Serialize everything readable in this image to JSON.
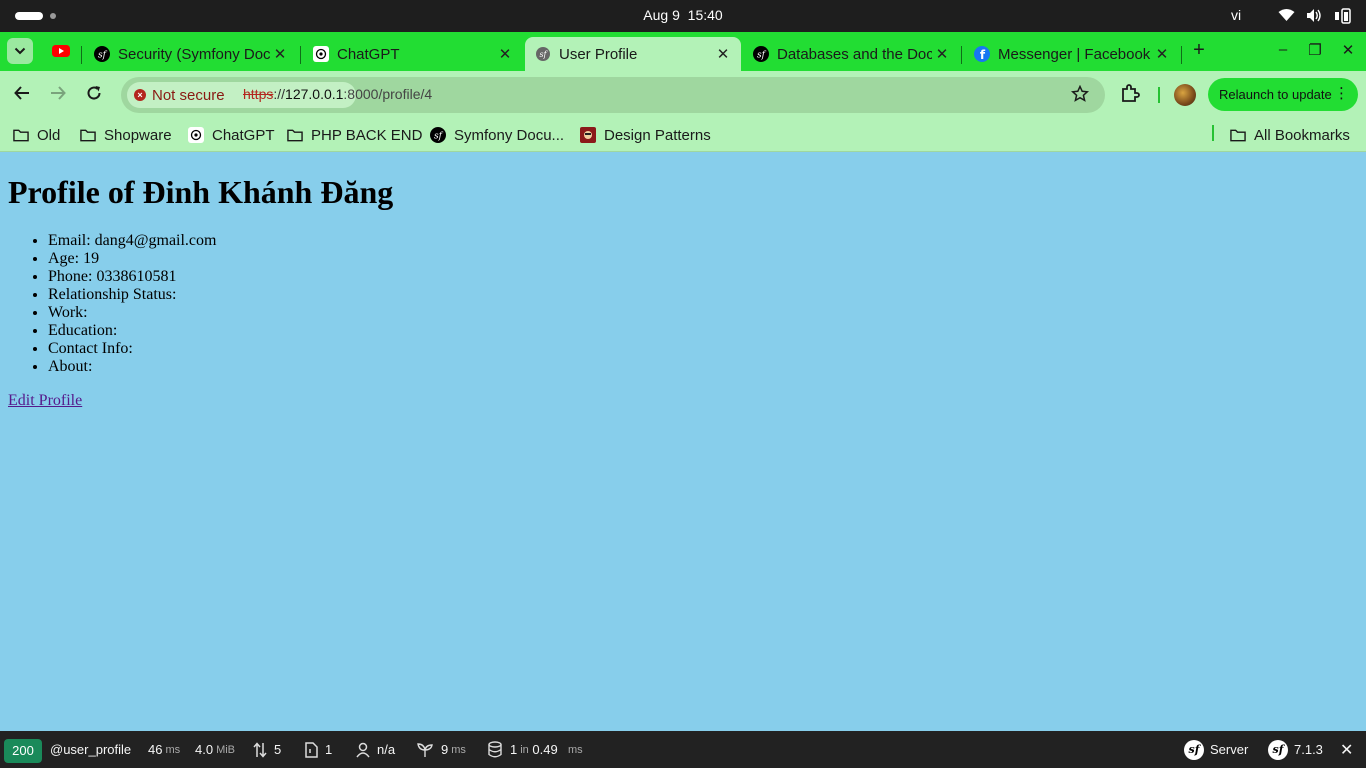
{
  "os": {
    "date": "Aug 9",
    "time": "15:40",
    "lang": "vi"
  },
  "tabs": [
    {
      "title": "Security (Symfony Docs)",
      "icon": "symfony-icon"
    },
    {
      "title": "ChatGPT",
      "icon": "chatgpt-icon"
    },
    {
      "title": "User Profile",
      "icon": "symfony-gray-icon",
      "active": true
    },
    {
      "title": "Databases and the Doctrine ORM",
      "icon": "symfony-icon"
    },
    {
      "title": "Messenger | Facebook",
      "icon": "facebook-icon"
    }
  ],
  "toolbar": {
    "security_label": "Not secure",
    "url_scheme": "https",
    "url_sep": "://",
    "url_host": "127.0.0.1",
    "url_path": ":8000/profile/4",
    "relaunch_label": "Relaunch to update"
  },
  "bookmarks": [
    {
      "label": "Old",
      "icon": "folder-icon"
    },
    {
      "label": "Shopware",
      "icon": "folder-icon"
    },
    {
      "label": "ChatGPT",
      "icon": "chatgpt-icon"
    },
    {
      "label": "PHP BACK END",
      "icon": "folder-icon"
    },
    {
      "label": "Symfony Docu...",
      "icon": "symfony-icon"
    },
    {
      "label": "Design Patterns",
      "icon": "design-patterns-icon"
    }
  ],
  "all_bookmarks_label": "All Bookmarks",
  "page": {
    "heading": "Profile of Đinh Khánh Đăng",
    "fields": [
      "Email: dang4@gmail.com",
      "Age: 19",
      "Phone: 0338610581",
      "Relationship Status:",
      "Work:",
      "Education:",
      "Contact Info:",
      "About:"
    ],
    "edit_link": "Edit Profile"
  },
  "debug_toolbar": {
    "status": "200",
    "route": "@user_profile",
    "time_value": "46",
    "time_unit": "ms",
    "memory_value": "4.0",
    "memory_unit": "MiB",
    "requests": "5",
    "templates": "1",
    "user": "n/a",
    "twig_value": "9",
    "twig_unit": "ms",
    "db_queries": "1",
    "db_in": "in",
    "db_time": "0.49",
    "db_unit": "ms",
    "server_label": "Server",
    "version": "7.1.3"
  },
  "colors": {
    "tab_strip": "#22dd33",
    "toolbar": "#b3f2b7",
    "page_background": "#87ceeb",
    "status_ok": "#1a8a5a"
  }
}
